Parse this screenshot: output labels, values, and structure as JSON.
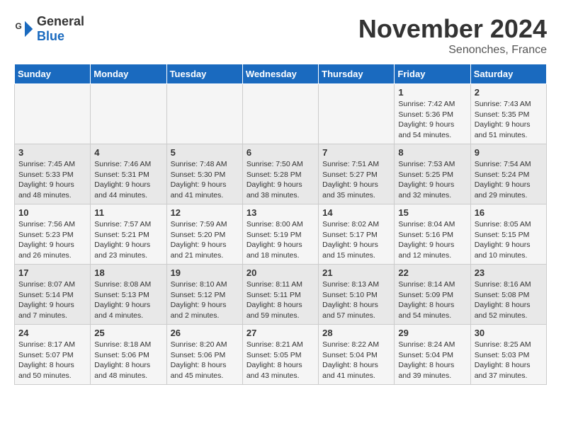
{
  "logo": {
    "general": "General",
    "blue": "Blue"
  },
  "header": {
    "month": "November 2024",
    "location": "Senonches, France"
  },
  "days_of_week": [
    "Sunday",
    "Monday",
    "Tuesday",
    "Wednesday",
    "Thursday",
    "Friday",
    "Saturday"
  ],
  "weeks": [
    [
      {
        "day": "",
        "info": ""
      },
      {
        "day": "",
        "info": ""
      },
      {
        "day": "",
        "info": ""
      },
      {
        "day": "",
        "info": ""
      },
      {
        "day": "",
        "info": ""
      },
      {
        "day": "1",
        "info": "Sunrise: 7:42 AM\nSunset: 5:36 PM\nDaylight: 9 hours\nand 54 minutes."
      },
      {
        "day": "2",
        "info": "Sunrise: 7:43 AM\nSunset: 5:35 PM\nDaylight: 9 hours\nand 51 minutes."
      }
    ],
    [
      {
        "day": "3",
        "info": "Sunrise: 7:45 AM\nSunset: 5:33 PM\nDaylight: 9 hours\nand 48 minutes."
      },
      {
        "day": "4",
        "info": "Sunrise: 7:46 AM\nSunset: 5:31 PM\nDaylight: 9 hours\nand 44 minutes."
      },
      {
        "day": "5",
        "info": "Sunrise: 7:48 AM\nSunset: 5:30 PM\nDaylight: 9 hours\nand 41 minutes."
      },
      {
        "day": "6",
        "info": "Sunrise: 7:50 AM\nSunset: 5:28 PM\nDaylight: 9 hours\nand 38 minutes."
      },
      {
        "day": "7",
        "info": "Sunrise: 7:51 AM\nSunset: 5:27 PM\nDaylight: 9 hours\nand 35 minutes."
      },
      {
        "day": "8",
        "info": "Sunrise: 7:53 AM\nSunset: 5:25 PM\nDaylight: 9 hours\nand 32 minutes."
      },
      {
        "day": "9",
        "info": "Sunrise: 7:54 AM\nSunset: 5:24 PM\nDaylight: 9 hours\nand 29 minutes."
      }
    ],
    [
      {
        "day": "10",
        "info": "Sunrise: 7:56 AM\nSunset: 5:23 PM\nDaylight: 9 hours\nand 26 minutes."
      },
      {
        "day": "11",
        "info": "Sunrise: 7:57 AM\nSunset: 5:21 PM\nDaylight: 9 hours\nand 23 minutes."
      },
      {
        "day": "12",
        "info": "Sunrise: 7:59 AM\nSunset: 5:20 PM\nDaylight: 9 hours\nand 21 minutes."
      },
      {
        "day": "13",
        "info": "Sunrise: 8:00 AM\nSunset: 5:19 PM\nDaylight: 9 hours\nand 18 minutes."
      },
      {
        "day": "14",
        "info": "Sunrise: 8:02 AM\nSunset: 5:17 PM\nDaylight: 9 hours\nand 15 minutes."
      },
      {
        "day": "15",
        "info": "Sunrise: 8:04 AM\nSunset: 5:16 PM\nDaylight: 9 hours\nand 12 minutes."
      },
      {
        "day": "16",
        "info": "Sunrise: 8:05 AM\nSunset: 5:15 PM\nDaylight: 9 hours\nand 10 minutes."
      }
    ],
    [
      {
        "day": "17",
        "info": "Sunrise: 8:07 AM\nSunset: 5:14 PM\nDaylight: 9 hours\nand 7 minutes."
      },
      {
        "day": "18",
        "info": "Sunrise: 8:08 AM\nSunset: 5:13 PM\nDaylight: 9 hours\nand 4 minutes."
      },
      {
        "day": "19",
        "info": "Sunrise: 8:10 AM\nSunset: 5:12 PM\nDaylight: 9 hours\nand 2 minutes."
      },
      {
        "day": "20",
        "info": "Sunrise: 8:11 AM\nSunset: 5:11 PM\nDaylight: 8 hours\nand 59 minutes."
      },
      {
        "day": "21",
        "info": "Sunrise: 8:13 AM\nSunset: 5:10 PM\nDaylight: 8 hours\nand 57 minutes."
      },
      {
        "day": "22",
        "info": "Sunrise: 8:14 AM\nSunset: 5:09 PM\nDaylight: 8 hours\nand 54 minutes."
      },
      {
        "day": "23",
        "info": "Sunrise: 8:16 AM\nSunset: 5:08 PM\nDaylight: 8 hours\nand 52 minutes."
      }
    ],
    [
      {
        "day": "24",
        "info": "Sunrise: 8:17 AM\nSunset: 5:07 PM\nDaylight: 8 hours\nand 50 minutes."
      },
      {
        "day": "25",
        "info": "Sunrise: 8:18 AM\nSunset: 5:06 PM\nDaylight: 8 hours\nand 48 minutes."
      },
      {
        "day": "26",
        "info": "Sunrise: 8:20 AM\nSunset: 5:06 PM\nDaylight: 8 hours\nand 45 minutes."
      },
      {
        "day": "27",
        "info": "Sunrise: 8:21 AM\nSunset: 5:05 PM\nDaylight: 8 hours\nand 43 minutes."
      },
      {
        "day": "28",
        "info": "Sunrise: 8:22 AM\nSunset: 5:04 PM\nDaylight: 8 hours\nand 41 minutes."
      },
      {
        "day": "29",
        "info": "Sunrise: 8:24 AM\nSunset: 5:04 PM\nDaylight: 8 hours\nand 39 minutes."
      },
      {
        "day": "30",
        "info": "Sunrise: 8:25 AM\nSunset: 5:03 PM\nDaylight: 8 hours\nand 37 minutes."
      }
    ]
  ]
}
